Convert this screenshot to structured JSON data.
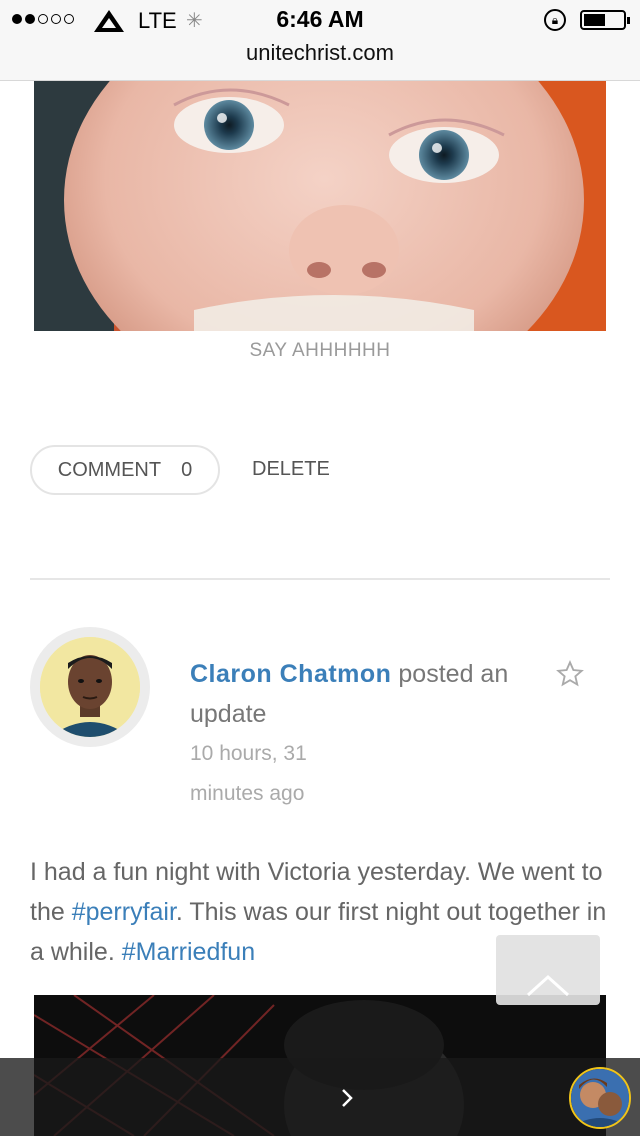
{
  "status_bar": {
    "signal": "●●○○○",
    "network": "LTE",
    "time": "6:46 AM",
    "battery_level": 0.55,
    "url": "unitechrist.com"
  },
  "photo_top": {
    "caption": "SAY AHHHHHH"
  },
  "actions": {
    "comment_label": "COMMENT",
    "comment_count": "0",
    "delete_label": "DELETE"
  },
  "post": {
    "author": "Claron Chatmon",
    "action_text": "posted an update",
    "time_ago": "10 hours, 31 minutes ago",
    "body_parts": [
      "I had a fun night with Victoria yesterday. We went to the ",
      "#perryfair",
      ". This was our first night out together in a while. ",
      "#Marriedfun"
    ]
  },
  "icons": {
    "favorite": "star-outline-icon",
    "scroll_top": "chevron-up-icon",
    "next": "chevron-right-icon"
  },
  "colors": {
    "accent": "#3b7fb9",
    "text": "#666666",
    "muted": "#aaaaaa"
  }
}
